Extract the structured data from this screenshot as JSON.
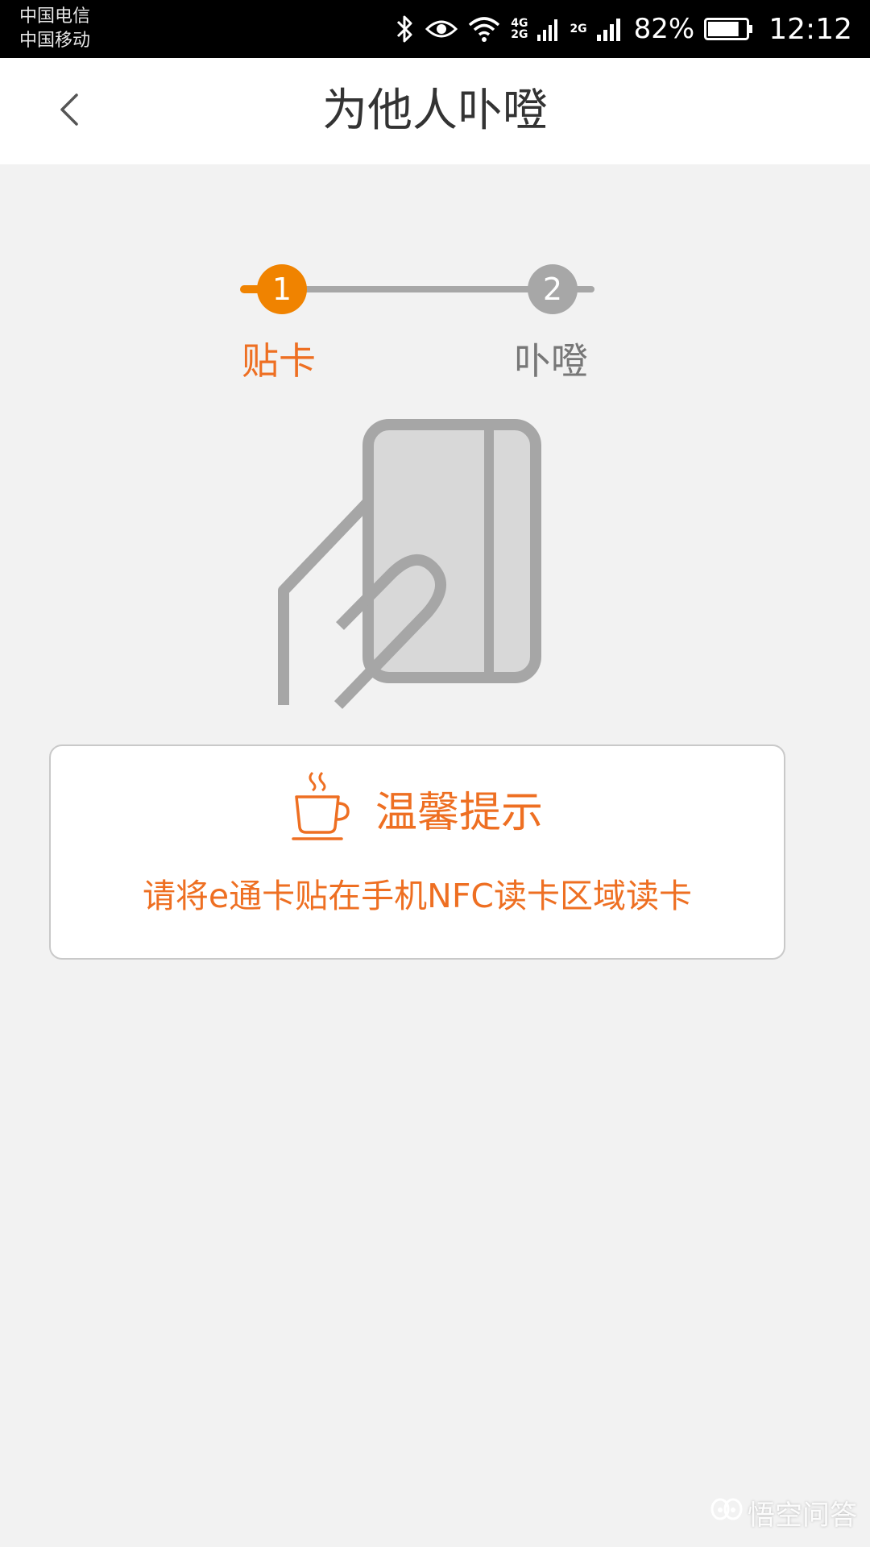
{
  "status_bar": {
    "carrier_1": "中国电信",
    "carrier_2": "中国移动",
    "net_tag_1_top": "4G",
    "net_tag_1_bottom": "2G",
    "net_tag_2": "2G",
    "battery_percent": "82%",
    "battery_level": 0.82,
    "time": "12:12",
    "icons": [
      "bluetooth-icon",
      "eye-icon",
      "wifi-icon",
      "signal-icon",
      "battery-icon"
    ]
  },
  "header": {
    "title": "为他人卟噔",
    "back_icon": "chevron-left-icon"
  },
  "stepper": {
    "steps": [
      {
        "number": "1",
        "label": "贴卡",
        "active": true
      },
      {
        "number": "2",
        "label": "卟噔",
        "active": false
      }
    ],
    "active_color": "#f08300",
    "inactive_color": "#a7a7a7"
  },
  "illustration": {
    "icon": "hand-holding-card-icon"
  },
  "tip": {
    "icon": "coffee-cup-icon",
    "title": "温馨提示",
    "text": "请将e通卡贴在手机NFC读卡区域读卡"
  },
  "watermark": {
    "icon": "wukong-logo-icon",
    "text": "悟空问答"
  }
}
